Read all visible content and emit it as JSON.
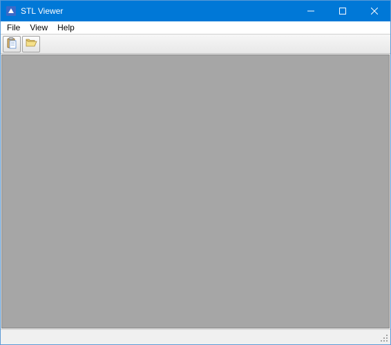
{
  "window": {
    "title": "STL Viewer"
  },
  "menu": {
    "items": [
      "File",
      "View",
      "Help"
    ]
  },
  "toolbar": {
    "paste_icon": "paste-icon",
    "open_icon": "folder-open-icon"
  }
}
